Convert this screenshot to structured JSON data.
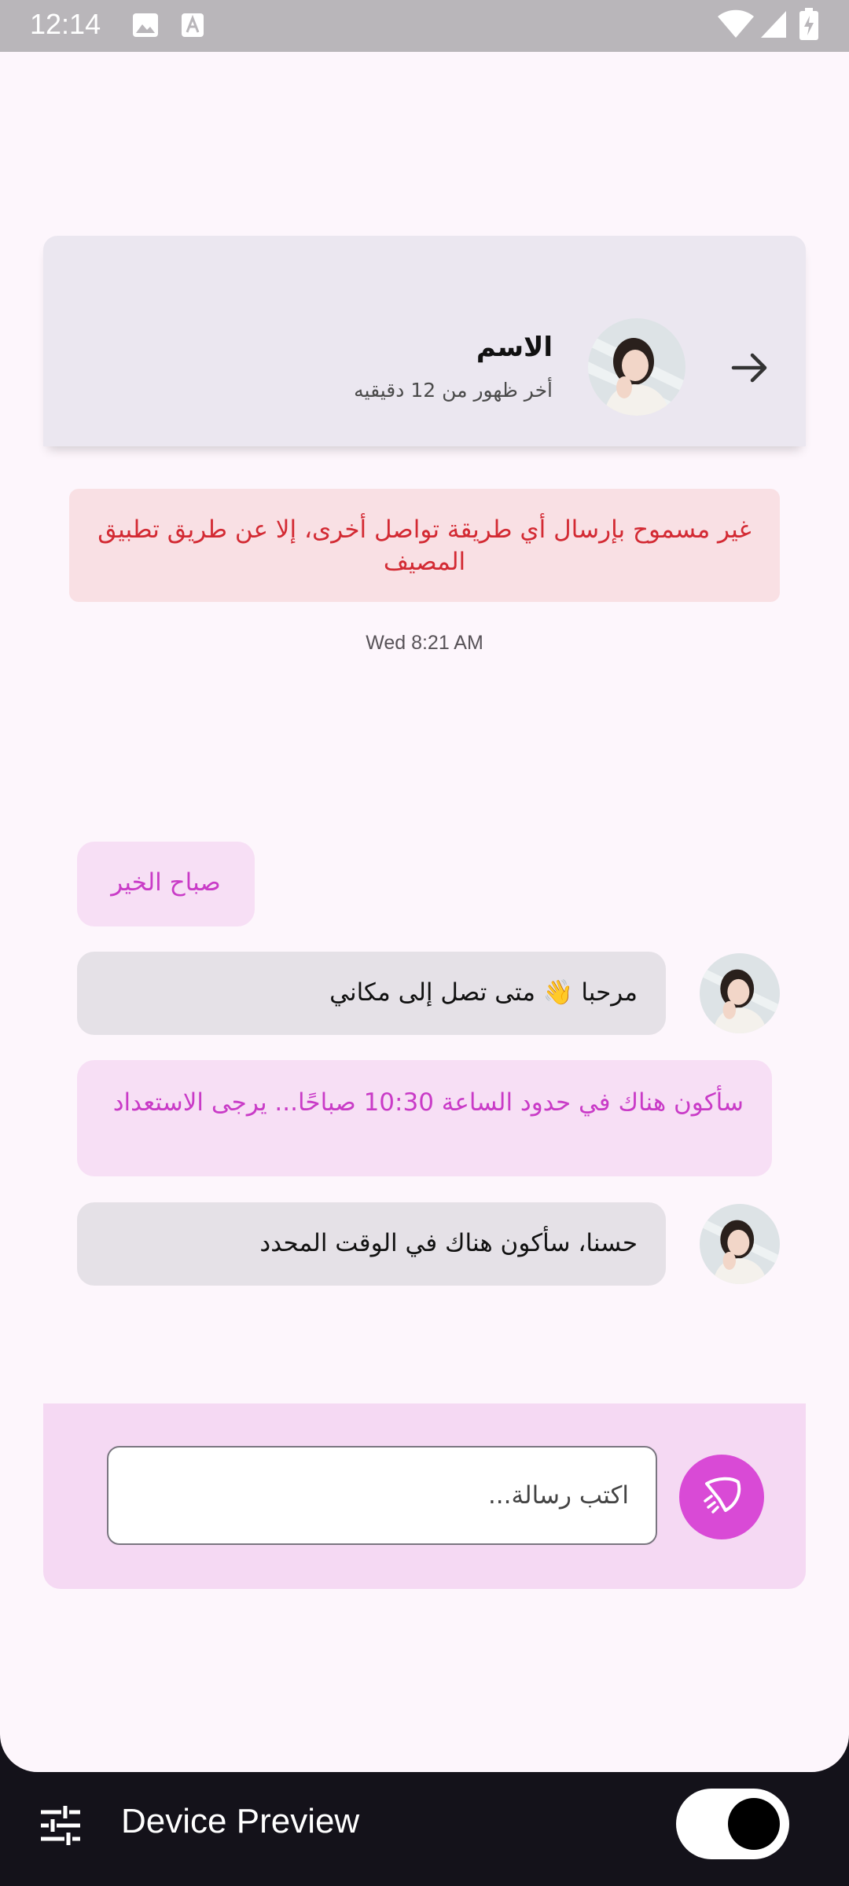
{
  "status_bar": {
    "time": "12:14"
  },
  "chat_header": {
    "name": "الاسم",
    "last_seen": "أخر ظهور من 12 دقيقيه"
  },
  "warning": "غير مسموح بإرسال أي طريقة تواصل أخرى، إلا عن طريق تطبيق المصيف",
  "timestamp": "Wed 8:21 AM",
  "messages": [
    {
      "text": "صباح الخير",
      "from": "me"
    },
    {
      "text": "مرحبا 👋 متى تصل إلى مكاني",
      "from": "other"
    },
    {
      "text": "سأكون هناك في حدود الساعة 10:30 صباحًا... يرجى الاستعداد",
      "from": "me"
    },
    {
      "text": "حسنا، سأكون هناك في الوقت المحدد",
      "from": "other"
    }
  ],
  "composer": {
    "placeholder": "اكتب رسالة...",
    "value": ""
  },
  "bottom_bar": {
    "label": "Device Preview",
    "toggle_on": true
  },
  "colors": {
    "accent": "#d94ad6",
    "my_bubble_bg": "#f7dff5",
    "my_bubble_text": "#c93bc7",
    "other_bubble_bg": "#e5e1e7",
    "warning_bg": "#f9e0e4",
    "warning_text": "#d32a33"
  },
  "icons": [
    "image-icon",
    "font-icon",
    "wifi-icon",
    "signal-icon",
    "battery-icon",
    "arrow-right-icon",
    "send-icon",
    "tune-icon"
  ]
}
